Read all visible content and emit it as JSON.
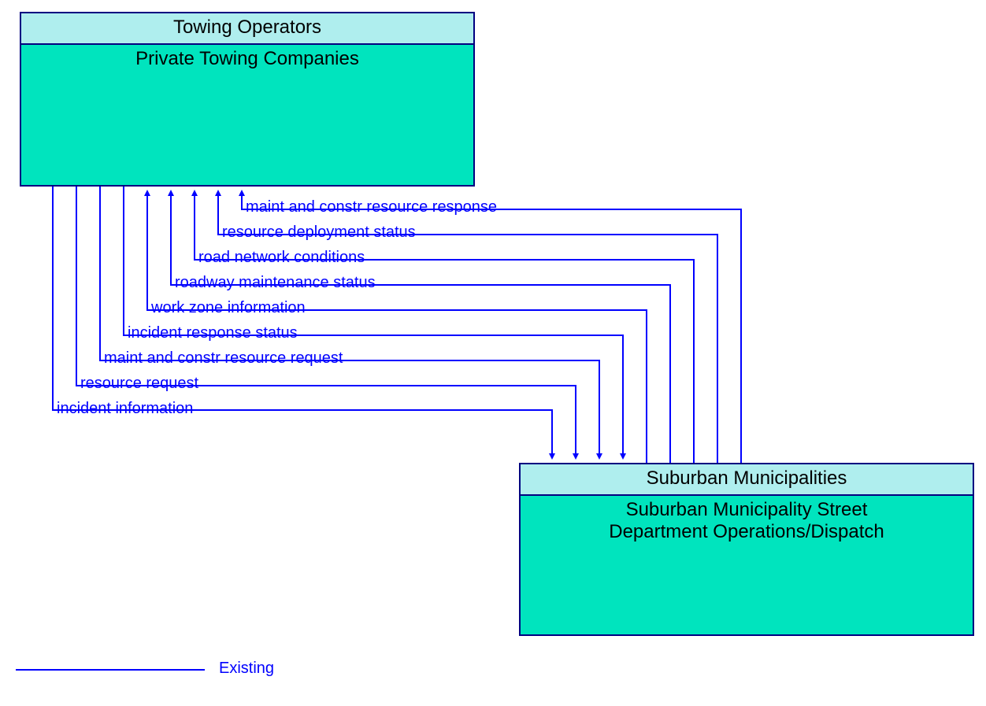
{
  "entities": {
    "top": {
      "header": "Towing Operators",
      "body": "Private Towing Companies"
    },
    "bottom": {
      "header": "Suburban Municipalities",
      "body_line1": "Suburban Municipality Street",
      "body_line2": "Department Operations/Dispatch"
    }
  },
  "flows": {
    "f1": "maint and constr resource response",
    "f2": "resource deployment status",
    "f3": "road network conditions",
    "f4": "roadway maintenance status",
    "f5": "work zone information",
    "f6": "incident response status",
    "f7": "maint and constr resource request",
    "f8": "resource request",
    "f9": "incident information"
  },
  "legend": {
    "existing": "Existing"
  },
  "colors": {
    "border": "#000080",
    "header_bg": "#afeeee",
    "body_bg": "#00e4be",
    "flow": "#0000ff"
  }
}
